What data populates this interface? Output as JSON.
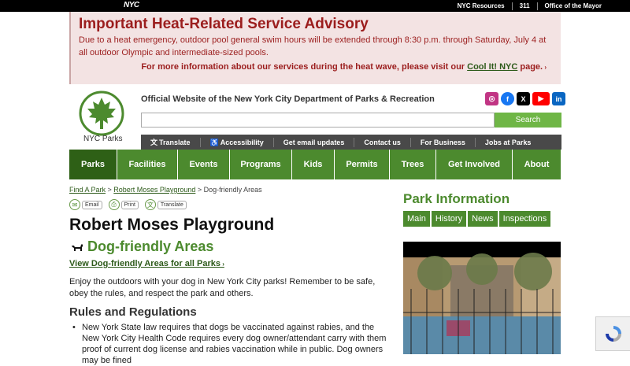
{
  "topbar": {
    "logo": "NYC",
    "links": [
      "NYC Resources",
      "311",
      "Office of the Mayor"
    ]
  },
  "advisory": {
    "title": "Important Heat-Related Service Advisory",
    "body": "Due to a heat emergency, outdoor pool general swim hours will be extended through 8:30 p.m. through Saturday, July 4 at all outdoor Olympic and intermediate-sized pools.",
    "more_prefix": "For more information about our services during the heat wave, please visit our ",
    "more_link": "Cool It! NYC",
    "more_suffix": " page."
  },
  "header": {
    "logo_label": "NYC Parks",
    "site_title": "Official Website of the New York City Department of Parks & Recreation",
    "search_placeholder": "",
    "search_button": "Search",
    "social": [
      {
        "icon": "instagram-icon",
        "glyph": "◎",
        "color": "#c13584"
      },
      {
        "icon": "facebook-icon",
        "glyph": "f",
        "color": "#1877f2"
      },
      {
        "icon": "x-icon",
        "glyph": "𝕏",
        "color": "#000000"
      },
      {
        "icon": "youtube-icon",
        "glyph": "▶",
        "color": "#ff0000"
      },
      {
        "icon": "linkedin-icon",
        "glyph": "in",
        "color": "#0a66c2"
      }
    ]
  },
  "utility_nav": [
    "Translate",
    "Accessibility",
    "Get email updates",
    "Contact us",
    "For Business",
    "Jobs at Parks"
  ],
  "main_nav": [
    "Parks",
    "Facilities",
    "Events",
    "Programs",
    "Kids",
    "Permits",
    "Trees",
    "Get Involved",
    "About"
  ],
  "breadcrumb": {
    "items": [
      "Find A Park",
      "Robert Moses Playground"
    ],
    "current": "Dog-friendly Areas",
    "sep": " > "
  },
  "tools": [
    "Email",
    "Print",
    "Translate"
  ],
  "page": {
    "title": "Robert Moses Playground",
    "section": "Dog-friendly Areas",
    "view_link": "View Dog-friendly Areas for all Parks",
    "intro": "Enjoy the outdoors with your dog in New York City parks! Remember to be safe, obey the rules, and respect the park and others.",
    "rules_head": "Rules and Regulations",
    "rule_1": "New York State law requires that dogs be vaccinated against rabies, and the New York City Health Code requires every dog owner/attendant carry with them proof of current dog license and rabies vaccination while in public. Dog owners may be fined"
  },
  "park_info": {
    "title": "Park Information",
    "tabs": [
      "Main",
      "History",
      "News",
      "Inspections"
    ]
  },
  "colors": {
    "brand_green": "#4c8a2e",
    "nav_active": "#2e6016",
    "advisory_red": "#9b1d1d",
    "advisory_bg": "#f3e3e3"
  }
}
